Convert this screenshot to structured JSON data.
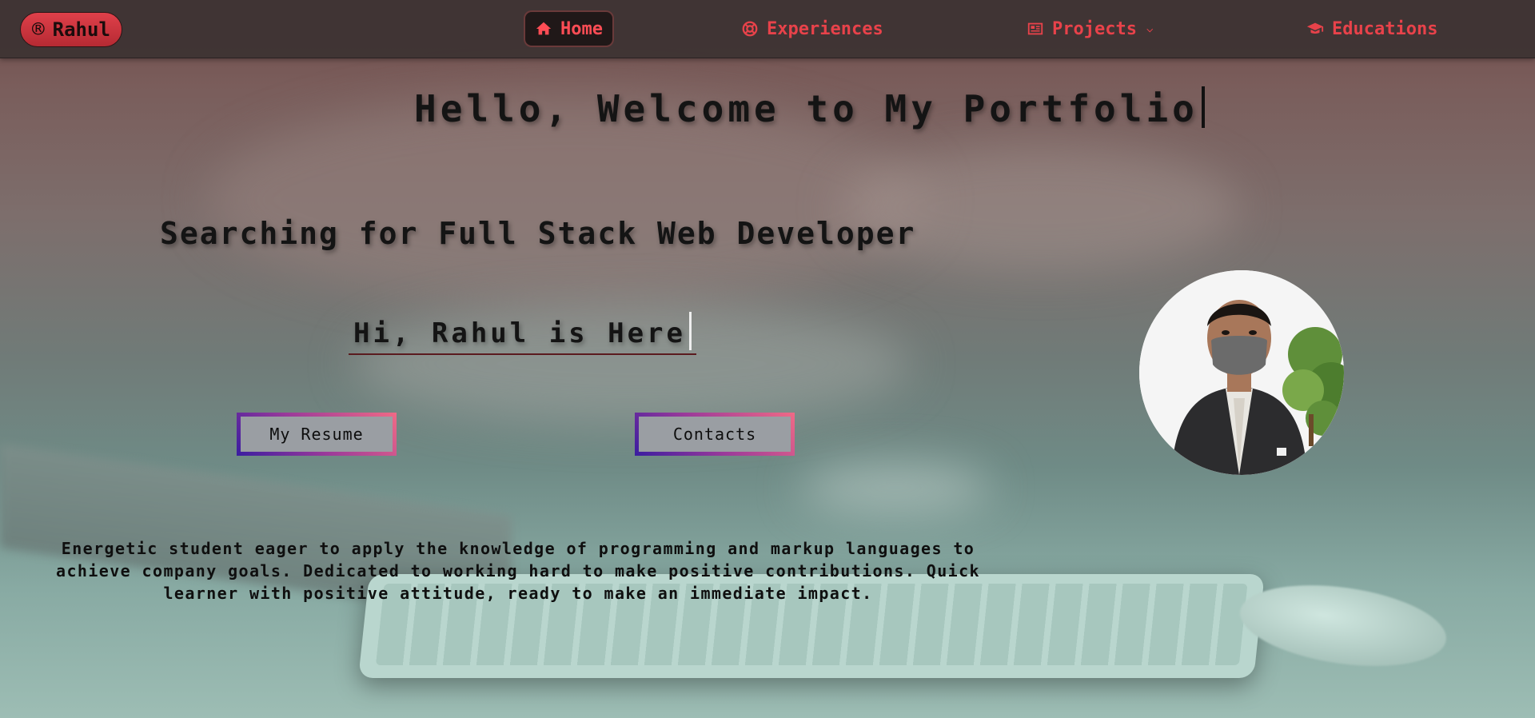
{
  "nav": {
    "brand": {
      "symbol": "®",
      "name": "Rahul"
    },
    "items": [
      {
        "label": "Home",
        "icon": "home-icon",
        "active": true
      },
      {
        "label": "Experiences",
        "icon": "lifebuoy-icon",
        "active": false
      },
      {
        "label": "Projects",
        "icon": "newspaper-icon",
        "active": false,
        "has_dropdown": true
      },
      {
        "label": "Educations",
        "icon": "graduation-cap-icon",
        "active": false
      }
    ],
    "accent_color": "#e8424a"
  },
  "hero": {
    "welcome": "Hello, Welcome to My Portfolio",
    "headline": "Searching for Full Stack Web Developer",
    "greeting": "Hi, Rahul is Here",
    "buttons": {
      "resume": "My Resume",
      "contacts": "Contacts"
    },
    "summary": "Energetic student eager to apply the knowledge of programming and markup languages to achieve company goals. Dedicated to working hard to make positive contributions. Quick learner with positive attitude, ready to make an immediate impact."
  },
  "profile": {
    "photo_icon": "profile-photo"
  }
}
